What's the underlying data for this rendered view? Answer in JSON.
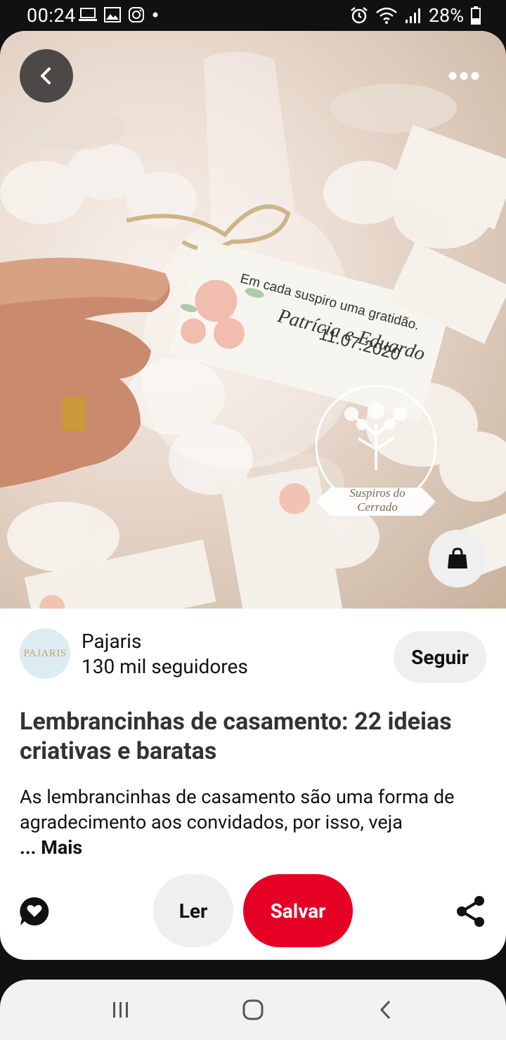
{
  "status_bar": {
    "time": "00:24",
    "battery": "28%",
    "icons": [
      "laptop-icon",
      "image-icon",
      "instagram-icon",
      "dot-icon",
      "alarm-icon",
      "wifi-icon",
      "signal-icon",
      "battery-icon"
    ]
  },
  "hero": {
    "tag_text_line1": "Em cada suspiro uma gratidão.",
    "tag_names": "Patrícia e Eduardo",
    "tag_date": "11.07.2020",
    "watermark": "Suspiros do Cerrado"
  },
  "author": {
    "avatar_text": "PAJARIS",
    "name": "Pajaris",
    "followers": "130 mil seguidores",
    "follow_label": "Seguir"
  },
  "pin": {
    "title": "Lembrancinhas de casamento: 22 ideias criativas e baratas",
    "description": "As lembrancinhas de casamento são uma forma de agradecimento aos convidados, por isso, veja",
    "more_label": "... Mais"
  },
  "actions": {
    "read_label": "Ler",
    "save_label": "Salvar"
  },
  "colors": {
    "save_red": "#e60023",
    "light_button": "#efefef",
    "status_bg": "#111111"
  }
}
